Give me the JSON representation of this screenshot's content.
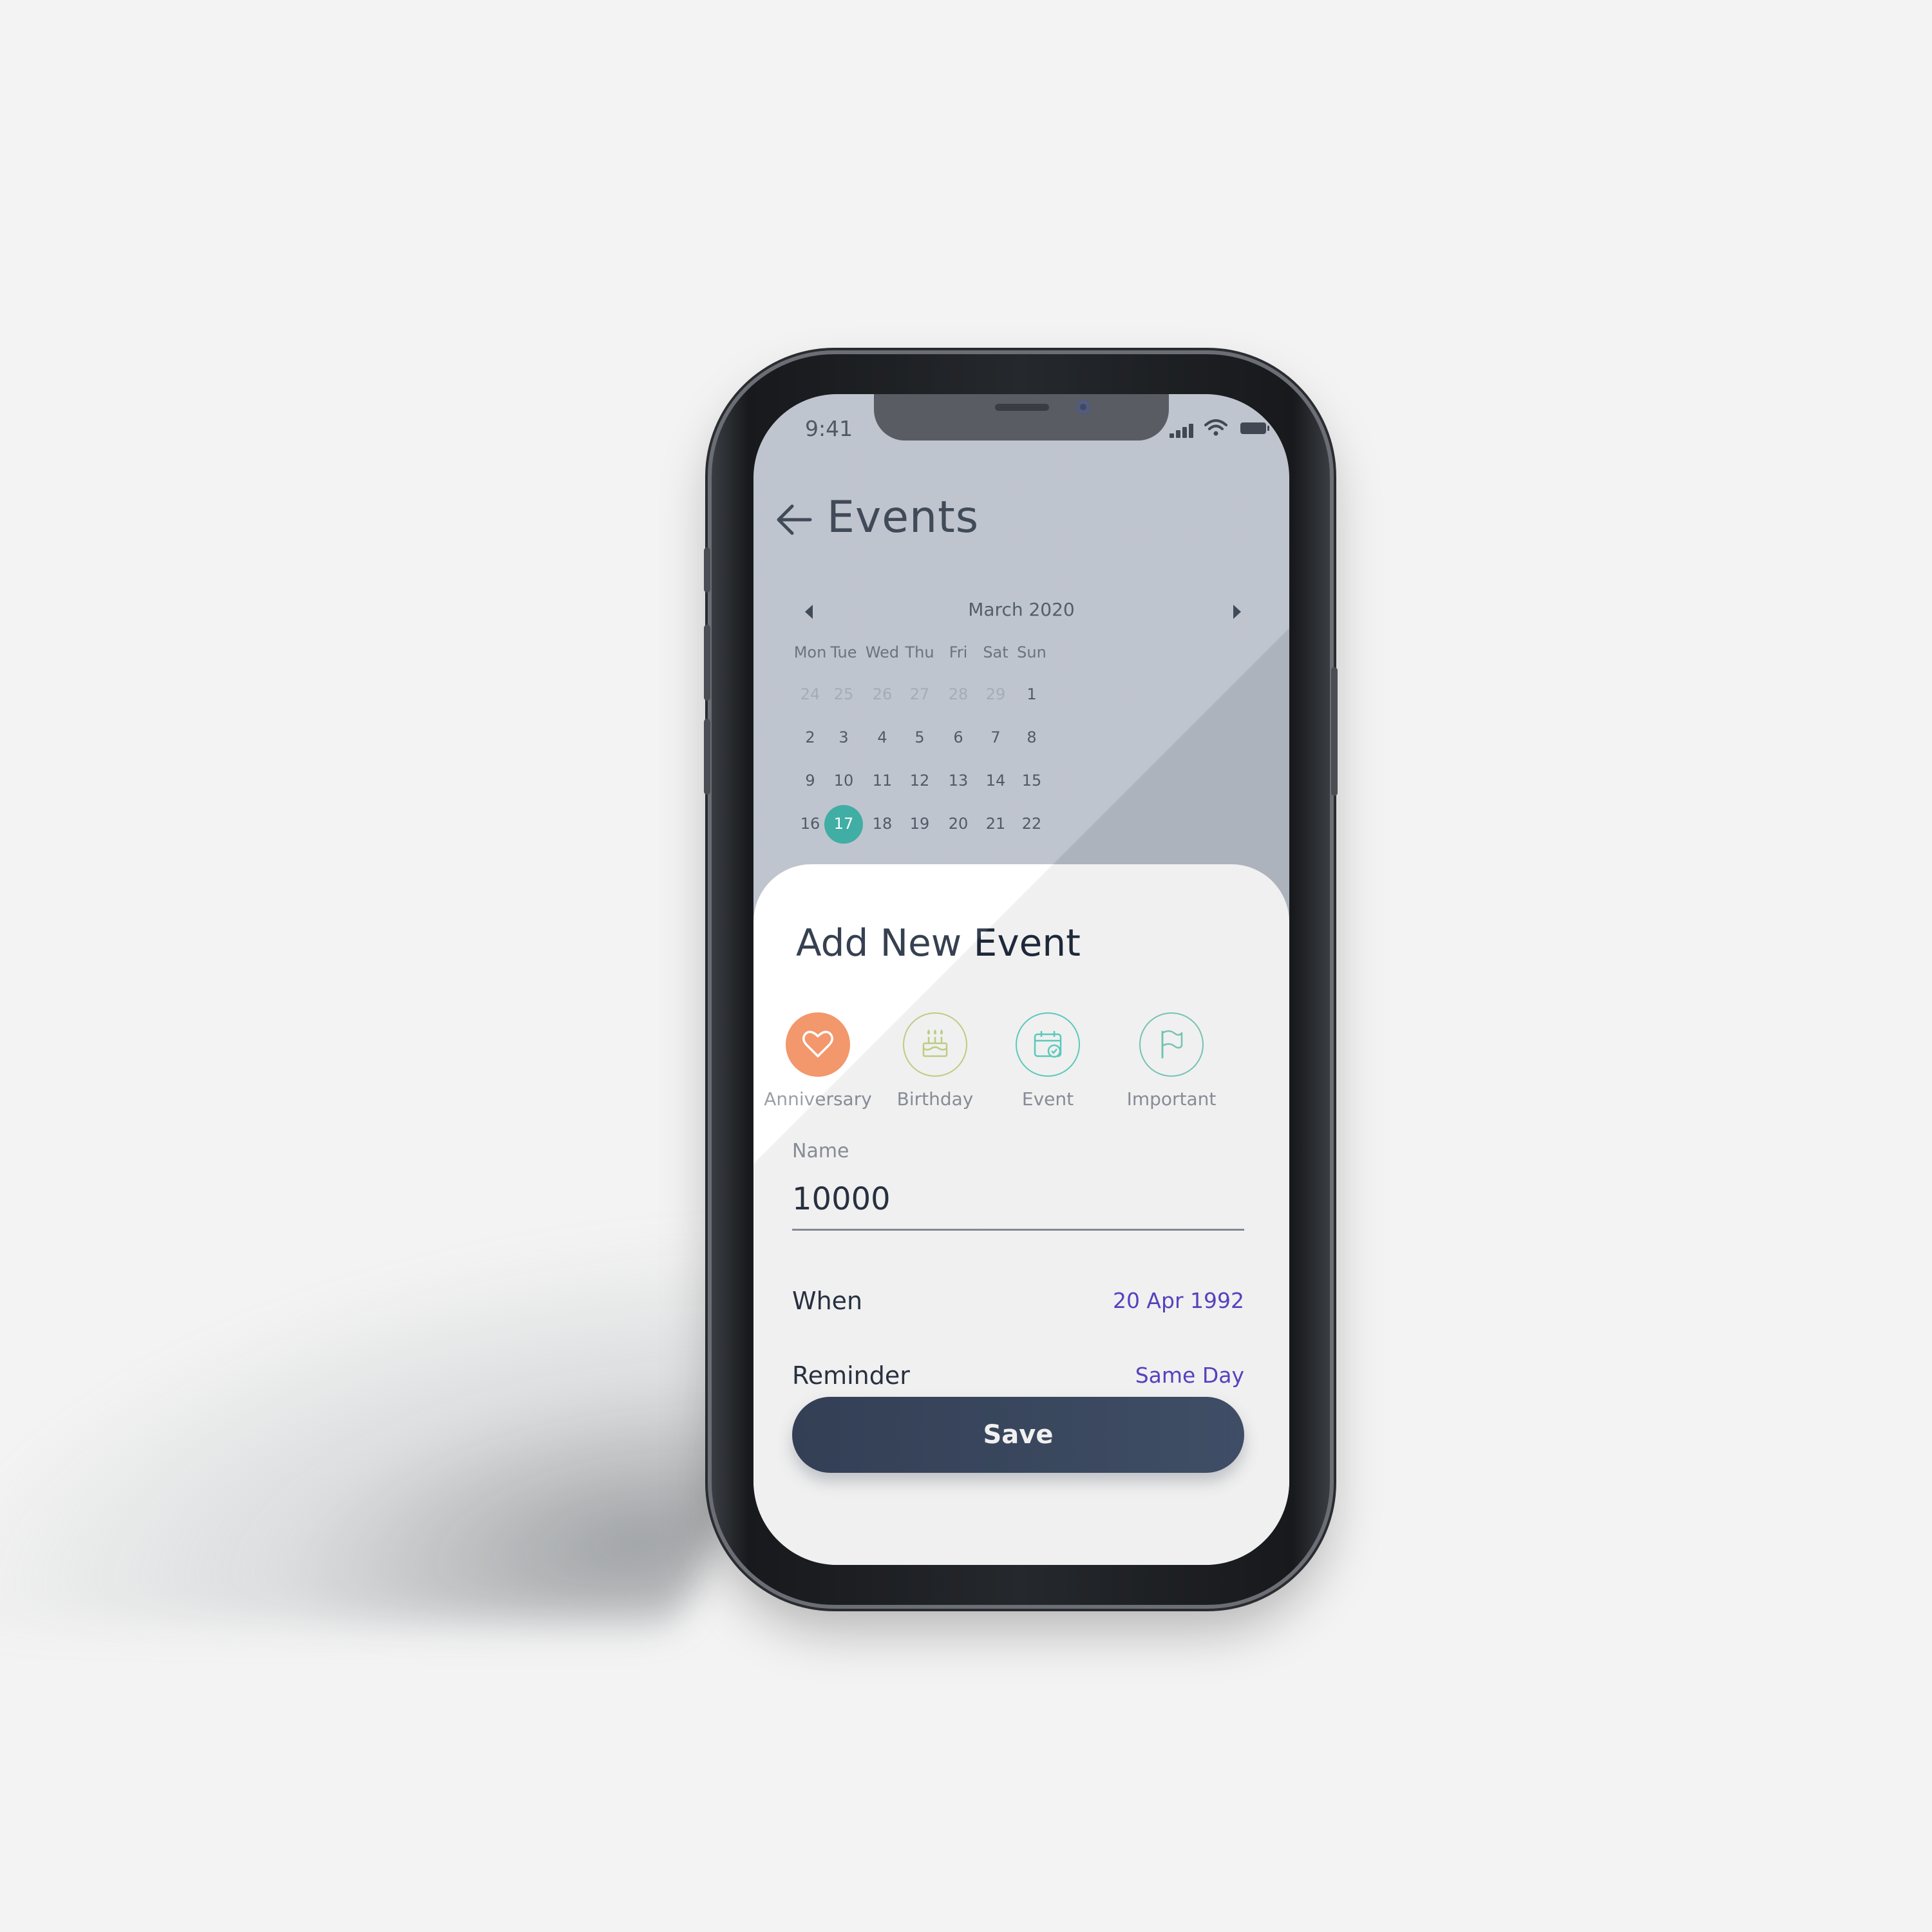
{
  "colors": {
    "background": "#f3f3f3",
    "overlay": "#b8bec8",
    "selected_day": "#2aa59a",
    "accent_value": "#5a46c9",
    "save_button": "#3b4862",
    "anniversary": "#f28b5b",
    "birthday": "#c8d98a",
    "event": "#5fd6c6",
    "important": "#7ccfbd"
  },
  "status_bar": {
    "time": "9:41",
    "icons": [
      "signal-icon",
      "wifi-icon",
      "battery-icon"
    ]
  },
  "header": {
    "back_icon": "back-arrow-icon",
    "title": "Events"
  },
  "calendar": {
    "month_label": "March 2020",
    "prev_icon": "caret-left-icon",
    "next_icon": "caret-right-icon",
    "weekdays": [
      "Mon",
      "Tue",
      "Wed",
      "Thu",
      "Fri",
      "Sat",
      "Sun"
    ],
    "weeks": [
      [
        "24",
        "25",
        "26",
        "27",
        "28",
        "29",
        "1"
      ],
      [
        "2",
        "3",
        "4",
        "5",
        "6",
        "7",
        "8"
      ],
      [
        "9",
        "10",
        "11",
        "12",
        "13",
        "14",
        "15"
      ],
      [
        "16",
        "17",
        "18",
        "19",
        "20",
        "21",
        "22"
      ]
    ],
    "muted_in_first_week": 6,
    "selected_day": "17"
  },
  "sheet": {
    "title": "Add New Event",
    "categories": [
      {
        "label": "Anniversary",
        "icon": "heart-icon",
        "selected": true
      },
      {
        "label": "Birthday",
        "icon": "cake-icon",
        "selected": false
      },
      {
        "label": "Event",
        "icon": "calendar-check-icon",
        "selected": false
      },
      {
        "label": "Important",
        "icon": "flag-icon",
        "selected": false
      }
    ],
    "name_label": "Name",
    "name_value": "10000",
    "when_label": "When",
    "when_value": "20 Apr 1992",
    "reminder_label": "Reminder",
    "reminder_value": "Same Day",
    "save_label": "Save"
  }
}
